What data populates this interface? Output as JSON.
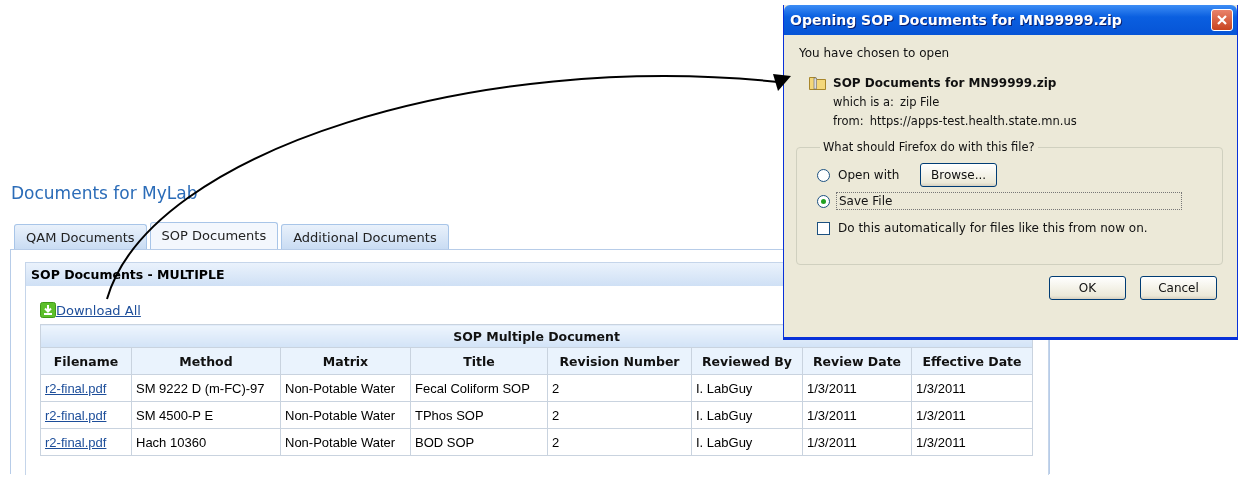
{
  "page": {
    "title": "Documents for MyLab"
  },
  "tabs": [
    {
      "label": "QAM Documents",
      "selected": false
    },
    {
      "label": "SOP Documents",
      "selected": true
    },
    {
      "label": "Additional Documents",
      "selected": false
    }
  ],
  "section": {
    "title": "SOP Documents - MULTIPLE",
    "download_link": "Download All"
  },
  "table": {
    "caption": "SOP Multiple Document",
    "columns": [
      "Filename",
      "Method",
      "Matrix",
      "Title",
      "Revision Number",
      "Reviewed By",
      "Review Date",
      "Effective Date"
    ],
    "rows": [
      {
        "cells": [
          "r2-final.pdf",
          "SM 9222 D (m-FC)-97",
          "Non-Potable Water",
          "Fecal Coliform SOP",
          "2",
          "I. LabGuy",
          "1/3/2011",
          "1/3/2011"
        ]
      },
      {
        "cells": [
          "r2-final.pdf",
          "SM 4500-P E",
          "Non-Potable Water",
          "TPhos SOP",
          "2",
          "I. LabGuy",
          "1/3/2011",
          "1/3/2011"
        ]
      },
      {
        "cells": [
          "r2-final.pdf",
          "Hach 10360",
          "Non-Potable Water",
          "BOD SOP",
          "2",
          "I. LabGuy",
          "1/3/2011",
          "1/3/2011"
        ]
      }
    ]
  },
  "dialog": {
    "title": "Opening SOP Documents for MN99999.zip",
    "intro": "You have chosen to open",
    "filename": "SOP Documents for MN99999.zip",
    "type_label": "which is a:",
    "type_value": "zip File",
    "from_label": "from:",
    "from_value": "https://apps-test.health.state.mn.us",
    "group_label": "What should Firefox do with this file?",
    "options": [
      {
        "label": "Open with",
        "selected": false,
        "button": "Browse..."
      },
      {
        "label": "Save File",
        "selected": true
      }
    ],
    "remember": {
      "label": "Do this automatically for files like this from now on.",
      "checked": false
    },
    "buttons": [
      "OK",
      "Cancel"
    ]
  }
}
